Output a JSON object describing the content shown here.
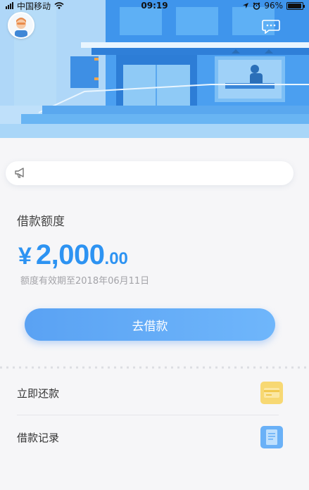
{
  "status_bar": {
    "carrier": "中国移动",
    "time": "09:19",
    "battery": "96%",
    "battery_level": 0.96
  },
  "header": {
    "avatar_icon": "user-avatar-icon",
    "message_icon": "chat-bubble-icon"
  },
  "notice": {
    "icon": "megaphone-icon",
    "text": ""
  },
  "credit": {
    "title": "借款额度",
    "currency": "¥",
    "amount_integer": "2,000",
    "amount_decimal": ".00",
    "validity": "额度有效期至2018年06月11日"
  },
  "actions": {
    "borrow_label": "去借款"
  },
  "menu": {
    "items": [
      {
        "label": "立即还款",
        "icon": "card-icon",
        "icon_color": "#f7d873"
      },
      {
        "label": "借款记录",
        "icon": "document-icon",
        "icon_color": "#6ab1f7"
      }
    ]
  },
  "colors": {
    "accent": "#2d93f2",
    "button_start": "#5aa2f3",
    "button_end": "#6fb6fb",
    "muted_text": "#a3a3a8"
  }
}
